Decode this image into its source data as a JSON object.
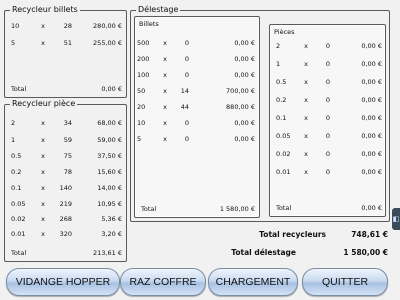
{
  "recycleur_billets": {
    "title": "Recycleur billets",
    "rows": [
      {
        "denom": "10",
        "x": "x",
        "qty": "28",
        "amount": "280,00 €"
      },
      {
        "denom": "5",
        "x": "x",
        "qty": "51",
        "amount": "255,00 €"
      }
    ],
    "total_label": "Total",
    "total_value": "0,00 €"
  },
  "recycleur_piece": {
    "title": "Recycleur pièce",
    "rows": [
      {
        "denom": "2",
        "x": "x",
        "qty": "34",
        "amount": "68,00 €"
      },
      {
        "denom": "1",
        "x": "x",
        "qty": "59",
        "amount": "59,00 €"
      },
      {
        "denom": "0.5",
        "x": "x",
        "qty": "75",
        "amount": "37,50 €"
      },
      {
        "denom": "0.2",
        "x": "x",
        "qty": "78",
        "amount": "15,60 €"
      },
      {
        "denom": "0.1",
        "x": "x",
        "qty": "140",
        "amount": "14,00 €"
      },
      {
        "denom": "0.05",
        "x": "x",
        "qty": "219",
        "amount": "10,95 €"
      },
      {
        "denom": "0.02",
        "x": "x",
        "qty": "268",
        "amount": "5,36 €"
      },
      {
        "denom": "0.01",
        "x": "x",
        "qty": "320",
        "amount": "3,20 €"
      }
    ],
    "total_label": "Total",
    "total_value": "213,61 €"
  },
  "delestage": {
    "title": "Délestage",
    "billets": {
      "title": "Billets",
      "rows": [
        {
          "denom": "500",
          "x": "x",
          "qty": "0",
          "amount": "0,00 €"
        },
        {
          "denom": "200",
          "x": "x",
          "qty": "0",
          "amount": "0,00 €"
        },
        {
          "denom": "100",
          "x": "x",
          "qty": "0",
          "amount": "0,00 €"
        },
        {
          "denom": "50",
          "x": "x",
          "qty": "14",
          "amount": "700,00 €"
        },
        {
          "denom": "20",
          "x": "x",
          "qty": "44",
          "amount": "880,00 €"
        },
        {
          "denom": "10",
          "x": "x",
          "qty": "0",
          "amount": "0,00 €"
        },
        {
          "denom": "5",
          "x": "x",
          "qty": "0",
          "amount": "0,00 €"
        }
      ],
      "total_label": "Total",
      "total_value": "1 580,00 €"
    },
    "pieces": {
      "title": "Pièces",
      "rows": [
        {
          "denom": "2",
          "x": "x",
          "qty": "0",
          "amount": "0,00 €"
        },
        {
          "denom": "1",
          "x": "x",
          "qty": "0",
          "amount": "0,00 €"
        },
        {
          "denom": "0.5",
          "x": "x",
          "qty": "0",
          "amount": "0,00 €"
        },
        {
          "denom": "0.2",
          "x": "x",
          "qty": "0",
          "amount": "0,00 €"
        },
        {
          "denom": "0.1",
          "x": "x",
          "qty": "0",
          "amount": "0,00 €"
        },
        {
          "denom": "0.05",
          "x": "x",
          "qty": "0",
          "amount": "0,00 €"
        },
        {
          "denom": "0.02",
          "x": "x",
          "qty": "0",
          "amount": "0,00 €"
        },
        {
          "denom": "0.01",
          "x": "x",
          "qty": "0",
          "amount": "0,00 €"
        }
      ],
      "total_label": "Total",
      "total_value": "0,00 €"
    }
  },
  "summary": {
    "total_recycleurs_label": "Total recycleurs",
    "total_recycleurs_value": "748,61 €",
    "total_delestage_label": "Total délestage",
    "total_delestage_value": "1 580,00 €"
  },
  "buttons": {
    "vidange_hopper": "VIDANGE HOPPER",
    "raz_coffre": "RAZ COFFRE",
    "chargement": "CHARGEMENT",
    "quitter": "QUITTER"
  },
  "side_tab": {
    "icon": "panel-expand-icon",
    "glyph": "◧"
  }
}
